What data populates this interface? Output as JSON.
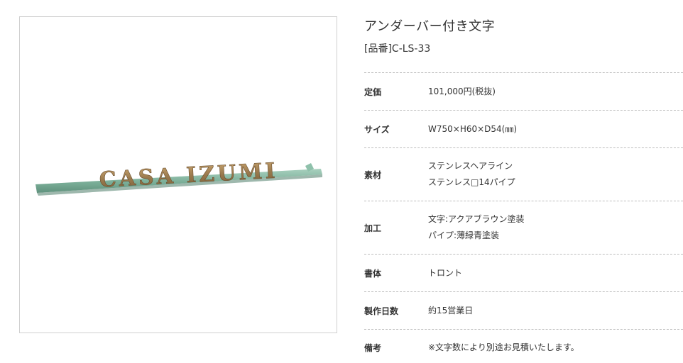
{
  "product": {
    "title": "アンダーバー付き文字",
    "code_line": "[品番]C-LS-33",
    "image": {
      "sign_text": "CASA IZUMI"
    }
  },
  "colors": {
    "text": "#333333",
    "divider": "#bdbdbd",
    "letter_bronze": "#9a7a4e",
    "pipe_green": "#7fb29c",
    "frame_border": "#cfcfcf"
  },
  "specs": [
    {
      "label": "定価",
      "lines": [
        "101,000円(税抜)"
      ]
    },
    {
      "label": "サイズ",
      "lines": [
        "W750×H60×D54(㎜)"
      ]
    },
    {
      "label": "素材",
      "lines": [
        "ステンレスヘアライン",
        "ステンレス□14パイプ"
      ]
    },
    {
      "label": "加工",
      "lines": [
        "文字:アクアブラウン塗装",
        "パイプ:薄緑青塗装"
      ]
    },
    {
      "label": "書体",
      "lines": [
        "トロント"
      ]
    },
    {
      "label": "製作日数",
      "lines": [
        "約15営業日"
      ]
    },
    {
      "label": "備考",
      "lines": [
        "※文字数により別途お見積いたします。"
      ]
    }
  ]
}
